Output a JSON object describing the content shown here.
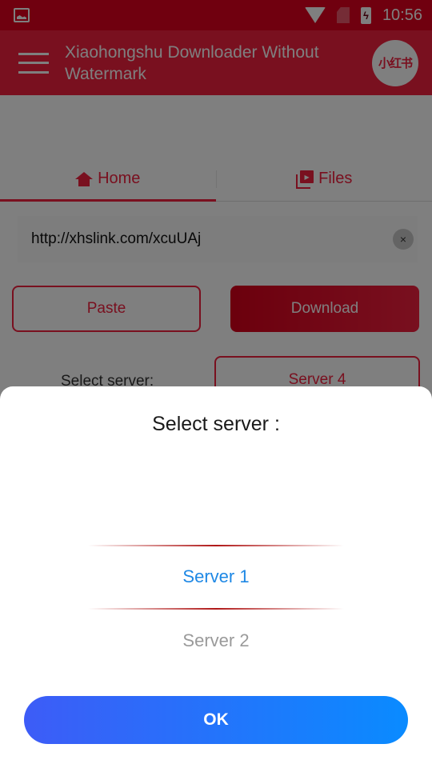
{
  "status_bar": {
    "time": "10:56",
    "icons": [
      "image-icon",
      "wifi-icon",
      "no-sim-icon",
      "battery-charging-icon"
    ]
  },
  "app_bar": {
    "title": "Xiaohongshu Downloader Without Watermark",
    "logo_text": "小红书"
  },
  "tabs": [
    {
      "label": "Home",
      "icon": "home-icon",
      "active": true
    },
    {
      "label": "Files",
      "icon": "video-library-icon",
      "active": false
    }
  ],
  "url_input": {
    "value": "http://xhslink.com/xcuUAj",
    "clear_icon": "×"
  },
  "actions": {
    "paste_label": "Paste",
    "download_label": "Download"
  },
  "server_row": {
    "label": "Select server:",
    "selected_server": "Server 4"
  },
  "dialog": {
    "title": "Select server :",
    "options": [
      "Server 1",
      "Server 2"
    ],
    "selected_option": "Server 1",
    "ok_label": "OK"
  },
  "colors": {
    "brand_red": "#f2203f",
    "picker_selected": "#1e88e5",
    "ok_gradient_start": "#3d5cf7",
    "ok_gradient_end": "#0a8bff"
  }
}
